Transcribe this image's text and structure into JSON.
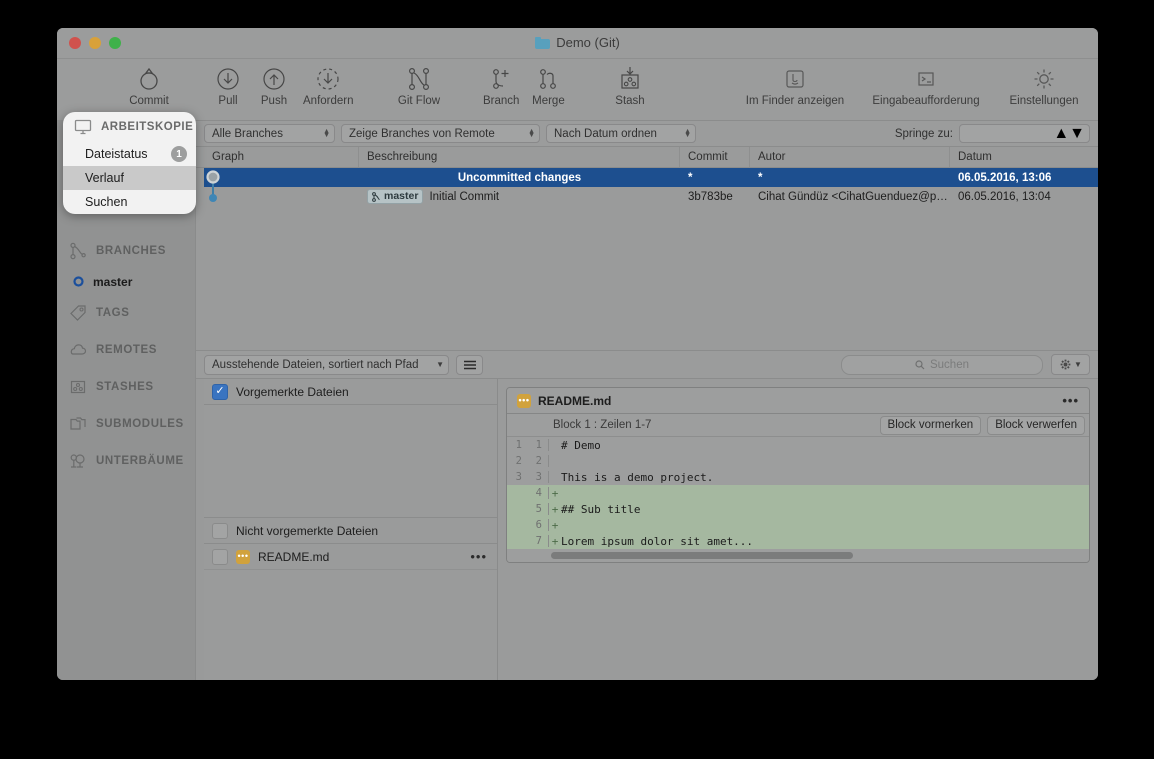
{
  "window": {
    "title": "Demo (Git)"
  },
  "toolbar": {
    "left": [
      {
        "label": "Commit",
        "icon": "commit-icon"
      },
      {
        "label": "Pull",
        "icon": "pull-icon"
      },
      {
        "label": "Push",
        "icon": "push-icon"
      },
      {
        "label": "Anfordern",
        "icon": "fetch-icon"
      },
      {
        "label": "Git Flow",
        "icon": "gitflow-icon"
      },
      {
        "label": "Branch",
        "icon": "branch-icon"
      },
      {
        "label": "Merge",
        "icon": "merge-icon"
      },
      {
        "label": "Stash",
        "icon": "stash-icon"
      }
    ],
    "right": [
      {
        "label": "Im Finder anzeigen",
        "icon": "finder-icon"
      },
      {
        "label": "Eingabeaufforderung",
        "icon": "terminal-icon"
      },
      {
        "label": "Einstellungen",
        "icon": "gear-icon"
      }
    ]
  },
  "filterbar": {
    "branches_filter": "Alle Branches",
    "remote_filter": "Zeige Branches von Remote",
    "order_filter": "Nach Datum ordnen",
    "jump_label": "Springe zu:",
    "jump_value": ""
  },
  "history": {
    "columns": [
      "Graph",
      "Beschreibung",
      "Commit",
      "Autor",
      "Datum"
    ],
    "rows": [
      {
        "description": "Uncommitted changes",
        "commit": "*",
        "author": "*",
        "date": "06.05.2016, 13:06",
        "selected": true,
        "branch_badge": ""
      },
      {
        "description": "Initial Commit",
        "commit": "3b783be",
        "author": "Cihat Gündüz <CihatGuenduez@posteo....",
        "date": "06.05.2016, 13:04",
        "selected": false,
        "branch_badge": "master"
      }
    ]
  },
  "midbar": {
    "sort_files": "Ausstehende Dateien, sortiert nach Pfad",
    "list_view_icon": "list-view-icon",
    "search_placeholder": "Suchen",
    "search_value": "",
    "gear_icon": "gear-icon"
  },
  "files": {
    "staged_label": "Vorgemerkte Dateien",
    "staged_checked": true,
    "staged_items": [],
    "unstaged_label": "Nicht vorgemerkte Dateien",
    "unstaged_checked": false,
    "unstaged_items": [
      {
        "name": "README.md",
        "checked": false,
        "icon": "markdown-file-icon",
        "menu": "•••"
      }
    ]
  },
  "diff": {
    "file_name": "README.md",
    "file_icon": "markdown-file-icon",
    "menu_icon": "•••",
    "hunk_title": "Block 1 : Zeilen 1-7",
    "stage_hunk": "Block vormerken",
    "discard_hunk": "Block verwerfen",
    "lines": [
      {
        "old": "1",
        "new": "1",
        "sign": "",
        "text": "# Demo",
        "added": false
      },
      {
        "old": "2",
        "new": "2",
        "sign": "",
        "text": "",
        "added": false
      },
      {
        "old": "3",
        "new": "3",
        "sign": "",
        "text": "This is a demo project.",
        "added": false
      },
      {
        "old": "",
        "new": "4",
        "sign": "+",
        "text": "",
        "added": true
      },
      {
        "old": "",
        "new": "5",
        "sign": "+",
        "text": "## Sub title",
        "added": true
      },
      {
        "old": "",
        "new": "6",
        "sign": "+",
        "text": "",
        "added": true
      },
      {
        "old": "",
        "new": "7",
        "sign": "+",
        "text": "Lorem ipsum dolor sit amet...",
        "added": true
      }
    ]
  },
  "sidebar": {
    "popover": {
      "header": "ARBEITSKOPIE",
      "header_icon": "workingcopy-icon",
      "items": [
        {
          "label": "Dateistatus",
          "badge": "1",
          "active": false
        },
        {
          "label": "Verlauf",
          "badge": "",
          "active": true
        },
        {
          "label": "Suchen",
          "badge": "",
          "active": false
        }
      ]
    },
    "sections": [
      {
        "label": "BRANCHES",
        "icon": "branches-icon"
      },
      {
        "label": "TAGS",
        "icon": "tag-icon"
      },
      {
        "label": "REMOTES",
        "icon": "cloud-icon"
      },
      {
        "label": "STASHES",
        "icon": "stash-icon"
      },
      {
        "label": "SUBMODULES",
        "icon": "submodules-icon"
      },
      {
        "label": "UNTERBÄUME",
        "icon": "subtrees-icon"
      }
    ],
    "branch": {
      "label": "master",
      "icon": "branch-dot-icon"
    }
  },
  "colors": {
    "selection": "#1d4f8f",
    "window_bg": "#999a9a",
    "added_line": "#a5b8a0",
    "accent_blue": "#3a74c0"
  }
}
